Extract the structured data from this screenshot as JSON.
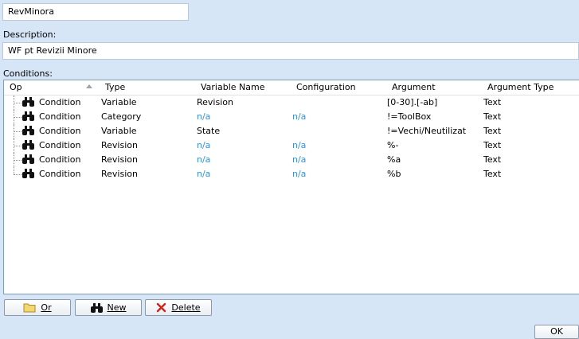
{
  "workflow": {
    "name": "RevMinora",
    "description_label": "Description:",
    "description": "WF pt Revizii Minore",
    "conditions_label": "Conditions:"
  },
  "table": {
    "columns": [
      "Op",
      "Type",
      "Variable Name",
      "Configuration",
      "Argument",
      "Argument Type"
    ],
    "rows": [
      {
        "op": "Condition",
        "type": "Variable",
        "variable": "Revision",
        "configuration": "",
        "argument": "[0-30].[-ab]",
        "argument_type": "Text"
      },
      {
        "op": "Condition",
        "type": "Category",
        "variable": "n/a",
        "configuration": "n/a",
        "argument": "!=ToolBox",
        "argument_type": "Text"
      },
      {
        "op": "Condition",
        "type": "Variable",
        "variable": "State",
        "configuration": "",
        "argument": "!=Vechi/Neutilizat",
        "argument_type": "Text"
      },
      {
        "op": "Condition",
        "type": "Revision",
        "variable": "n/a",
        "configuration": "n/a",
        "argument": "%-",
        "argument_type": "Text"
      },
      {
        "op": "Condition",
        "type": "Revision",
        "variable": "n/a",
        "configuration": "n/a",
        "argument": "%a",
        "argument_type": "Text"
      },
      {
        "op": "Condition",
        "type": "Revision",
        "variable": "n/a",
        "configuration": "n/a",
        "argument": "%b",
        "argument_type": "Text"
      }
    ]
  },
  "buttons": {
    "or": "Or",
    "new": "New",
    "delete": "Delete",
    "ok": "OK"
  },
  "icons": {
    "row_op": "binoculars-icon",
    "or": "folder-icon",
    "new": "binoculars-icon",
    "delete": "red-x-icon"
  },
  "colors": {
    "background": "#d6e6f7",
    "na_text": "#3c8fd0"
  }
}
